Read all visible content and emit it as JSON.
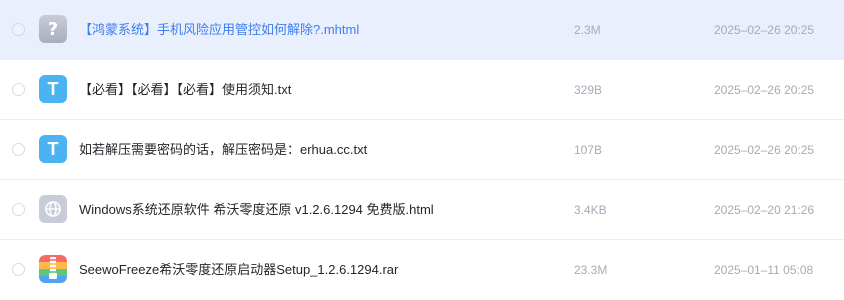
{
  "files": [
    {
      "icon": "unknown-file-icon",
      "icon_glyph": "?",
      "name": "【鸿蒙系统】手机风险应用管控如何解除?.mhtml",
      "size": "2.3M",
      "date": "2025–02–26 20:25",
      "selected": true
    },
    {
      "icon": "txt-file-icon",
      "icon_glyph": "T",
      "name": "【必看】【必看】【必看】使用须知.txt",
      "size": "329B",
      "date": "2025–02–26 20:25",
      "selected": false
    },
    {
      "icon": "txt-file-icon",
      "icon_glyph": "T",
      "name": "如若解压需要密码的话，解压密码是：erhua.cc.txt",
      "size": "107B",
      "date": "2025–02–26 20:25",
      "selected": false
    },
    {
      "icon": "html-file-icon",
      "icon_glyph": "",
      "name": "Windows系统还原软件 希沃零度还原 v1.2.6.1294 免费版.html",
      "size": "3.4KB",
      "date": "2025–02–20 21:26",
      "selected": false
    },
    {
      "icon": "rar-archive-icon",
      "icon_glyph": "",
      "name": "SeewoFreeze希沃零度还原启动器Setup_1.2.6.1294.rar",
      "size": "23.3M",
      "date": "2025–01–11 05:08",
      "selected": false
    }
  ],
  "colors": {
    "selected_row_bg": "#e9effc",
    "selected_name": "#3d7ef0",
    "text": "#25262b",
    "meta": "#a6abb5",
    "txt_icon": "#4bb3f1"
  }
}
